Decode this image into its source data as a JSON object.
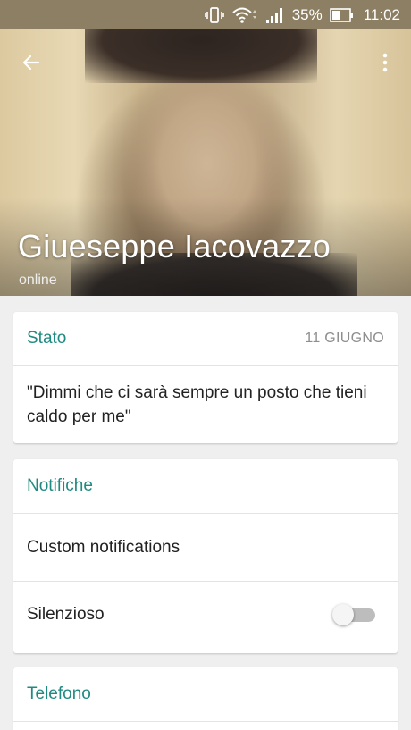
{
  "status_bar": {
    "battery_percent": "35%",
    "time": "11:02",
    "icons": [
      "vibrate-icon",
      "wifi-icon",
      "signal-icon",
      "battery-icon"
    ]
  },
  "header": {
    "back_icon": "arrow-left-icon",
    "menu_icon": "more-vertical-icon",
    "name": "Giueseppe Iacovazzo",
    "presence": "online"
  },
  "status_card": {
    "title": "Stato",
    "date": "11 GIUGNO",
    "text": "\"Dimmi che ci sarà sempre un posto che tieni caldo per me\""
  },
  "notifications_card": {
    "title": "Notifiche",
    "custom_label": "Custom notifications",
    "mute_label": "Silenzioso",
    "mute_on": false
  },
  "phone_card": {
    "title": "Telefono"
  },
  "colors": {
    "accent": "#1f8a80",
    "status_bar": "#8d7f63"
  }
}
